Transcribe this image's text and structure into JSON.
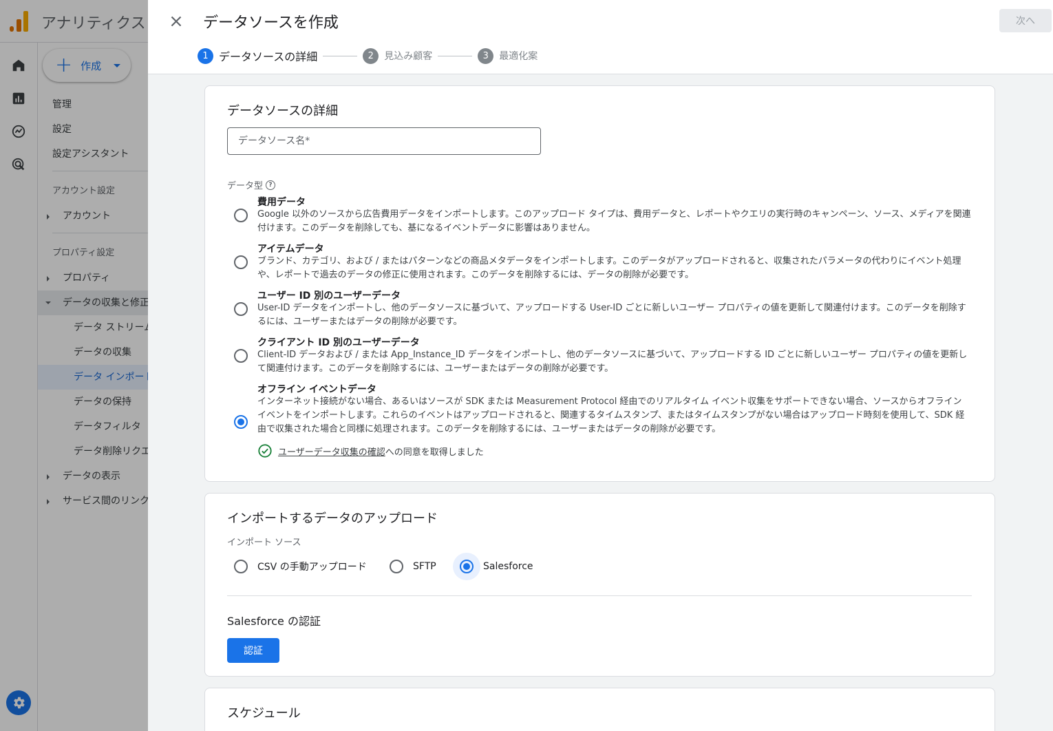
{
  "background": {
    "app_title": "アナリティクス",
    "create_button": "作成",
    "nav": {
      "admin": "管理",
      "settings": "設定",
      "setup_assistant": "設定アシスタント",
      "account_settings_header": "アカウント設定",
      "account": "アカウント",
      "property_settings_header": "プロパティ設定",
      "property": "プロパティ",
      "data_collection": "データの収集と修正",
      "data_streams": "データ ストリーム",
      "data_collection_sub": "データの収集",
      "data_import": "データ インポート",
      "data_retention": "データの保持",
      "data_filters": "データフィルタ",
      "data_deletion": "データ削除リクエ",
      "data_display": "データの表示",
      "service_links": "サービス間のリンク"
    }
  },
  "dialog": {
    "title": "データソースを作成",
    "next_button": "次へ",
    "steps": [
      {
        "num": "1",
        "label": "データソースの詳細"
      },
      {
        "num": "2",
        "label": "見込み顧客"
      },
      {
        "num": "3",
        "label": "最適化案"
      }
    ],
    "details": {
      "title": "データソースの詳細",
      "name_placeholder": "データソース名*",
      "type_label": "データ型",
      "options": [
        {
          "title": "費用データ",
          "desc": "Google 以外のソースから広告費用データをインポートします。このアップロード タイプは、費用データと、レポートやクエリの実行時のキャンペーン、ソース、メディアを関連付けます。このデータを削除しても、基になるイベントデータに影響はありません。"
        },
        {
          "title": "アイテムデータ",
          "desc": "ブランド、カテゴリ、および / またはパターンなどの商品メタデータをインポートします。このデータがアップロードされると、収集されたパラメータの代わりにイベント処理や、レポートで過去のデータの修正に使用されます。このデータを削除するには、データの削除が必要です。"
        },
        {
          "title": "ユーザー ID 別のユーザーデータ",
          "desc": "User-ID データをインポートし、他のデータソースに基づいて、アップロードする User-ID ごとに新しいユーザー プロパティの値を更新して関連付けます。このデータを削除するには、ユーザーまたはデータの削除が必要です。"
        },
        {
          "title": "クライアント ID 別のユーザーデータ",
          "desc": "Client-ID データおよび / または App_Instance_ID データをインポートし、他のデータソースに基づいて、アップロードする ID ごとに新しいユーザー プロパティの値を更新して関連付けます。このデータを削除するには、ユーザーまたはデータの削除が必要です。"
        },
        {
          "title": "オフライン イベントデータ",
          "desc": "インターネット接続がない場合、あるいはソースが SDK または Measurement Protocol 経由でのリアルタイム イベント収集をサポートできない場合、ソースからオフライン イベントをインポートします。これらのイベントはアップロードされると、関連するタイムスタンプ、またはタイムスタンプがない場合はアップロード時刻を使用して、SDK 経由で収集された場合と同様に処理されます。このデータを削除するには、ユーザーまたはデータの削除が必要です。"
        }
      ],
      "selected_option": "オフライン イベントデータ",
      "consent_link": "ユーザーデータ収集の確認",
      "consent_suffix": "への同意を取得しました"
    },
    "upload": {
      "title": "インポートするデータのアップロード",
      "source_label": "インポート ソース",
      "sources": [
        "CSV の手動アップロード",
        "SFTP",
        "Salesforce"
      ],
      "selected_source": "Salesforce",
      "auth_title": "Salesforce の認証",
      "auth_button": "認証"
    },
    "schedule": {
      "title": "スケジュール"
    }
  },
  "colors": {
    "accent": "#1a73e8",
    "success": "#188038"
  }
}
